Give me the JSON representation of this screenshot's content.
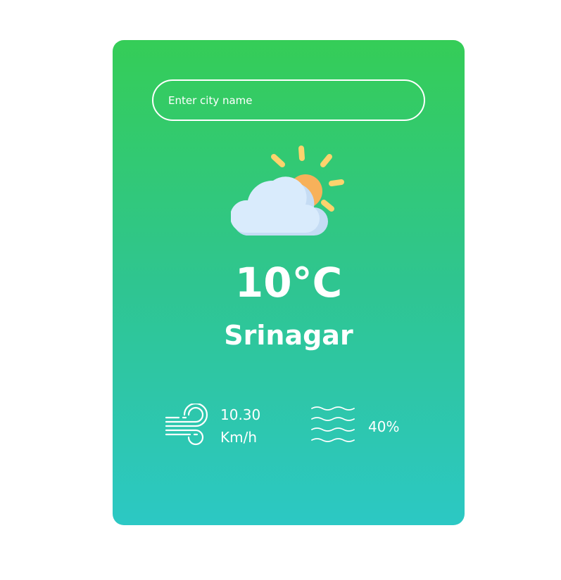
{
  "search": {
    "placeholder": "Enter city name",
    "value": ""
  },
  "weather": {
    "icon": "partly-cloudy-icon",
    "temperature": "10°C",
    "city": "Srinagar"
  },
  "wind": {
    "icon": "wind-icon",
    "speed_value": "10.30",
    "speed_unit": "Km/h"
  },
  "humidity": {
    "icon": "humidity-icon",
    "value": "40%"
  },
  "colors": {
    "gradient_top": "#35cd57",
    "gradient_bottom": "#2cc8c4",
    "sun": "#f7b15a",
    "sun_rays": "#fdd36d",
    "cloud": "#d9ebfc",
    "cloud_shadow": "#c5dcf4"
  }
}
